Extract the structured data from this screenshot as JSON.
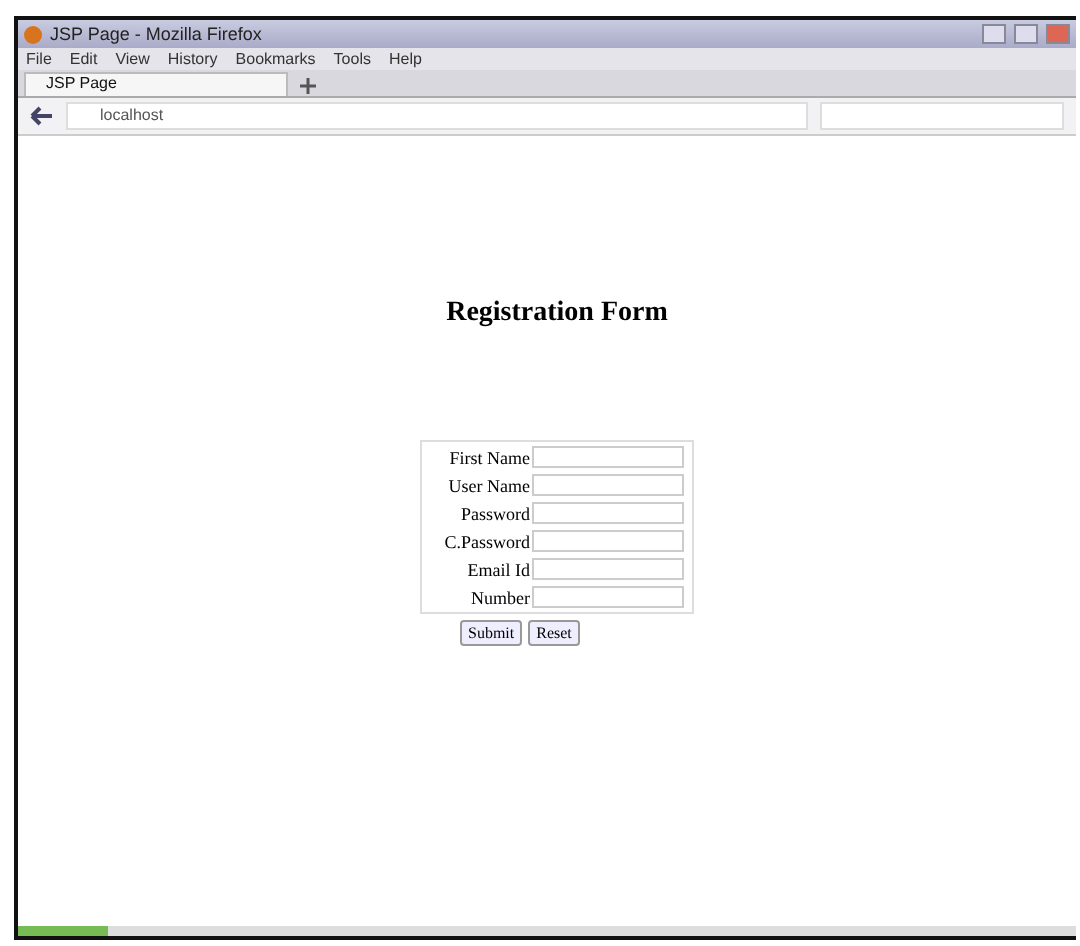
{
  "window": {
    "title": "JSP Page - Mozilla Firefox"
  },
  "menu": [
    "File",
    "Edit",
    "View",
    "History",
    "Bookmarks",
    "Tools",
    "Help"
  ],
  "tabs": [
    {
      "label": "JSP Page",
      "selected": true
    }
  ],
  "address_bar": {
    "value": "localhost"
  },
  "page": {
    "heading": "Registration Form",
    "fields": [
      {
        "label": "First Name"
      },
      {
        "label": "User Name"
      },
      {
        "label": "Password"
      },
      {
        "label": "C.Password"
      },
      {
        "label": "Email Id"
      },
      {
        "label": "Number"
      }
    ],
    "buttons": [
      "Submit",
      "Reset"
    ]
  }
}
